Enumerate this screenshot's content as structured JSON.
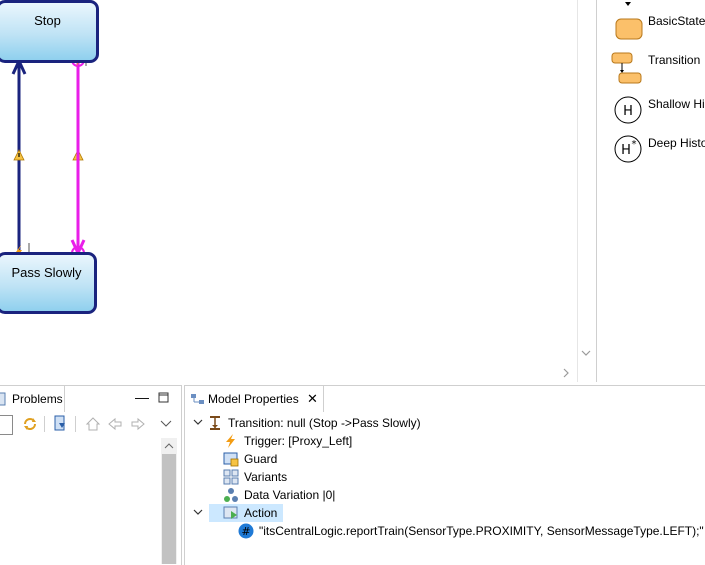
{
  "diagram": {
    "states": [
      {
        "id": "stop",
        "label": "Stop"
      },
      {
        "id": "pass_slowly",
        "label": "Pass Slowly"
      }
    ],
    "transition_colors": {
      "normal": "#1a237e",
      "selected": "#e91ee9"
    },
    "state_border": "#1a237e"
  },
  "palette": {
    "items": [
      {
        "label": "BasicState",
        "icon": "basic-state-icon"
      },
      {
        "label": "Transition",
        "icon": "transition-icon"
      },
      {
        "label": "Shallow His",
        "icon": "shallow-history-icon"
      },
      {
        "label": "Deep Histo",
        "icon": "deep-history-icon"
      }
    ]
  },
  "problems": {
    "tab_label": "Problems"
  },
  "properties": {
    "tab_label": "Model Properties",
    "tree": {
      "root": "Transition: null (Stop ->Pass Slowly)",
      "trigger": "Trigger: [Proxy_Left]",
      "guard": "Guard",
      "variants": "Variants",
      "data_variation": "Data Variation |0|",
      "action": "Action",
      "action_code": "\"itsCentralLogic.reportTrain(SensorType.PROXIMITY, SensorMessageType.LEFT);\""
    }
  }
}
